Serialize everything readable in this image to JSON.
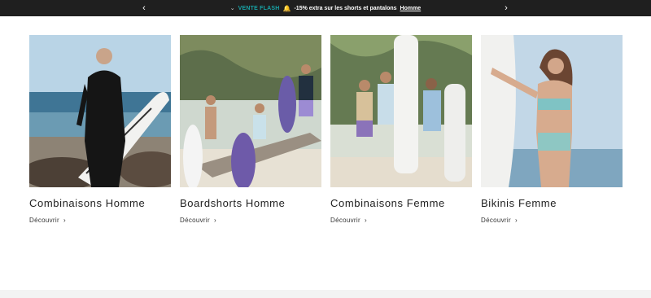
{
  "announcement": {
    "prev_icon": "chevron-left-icon",
    "next_icon": "chevron-right-icon",
    "chevron": "⌄",
    "flash_label": "VENTE FLASH",
    "bell_icon": "🔔",
    "message": "-15% extra sur les shorts et pantalons",
    "link_label": "Homme",
    "colors": {
      "bar": "#1f1f1f",
      "flash": "#18a3a6",
      "bell": "#e2b32a"
    }
  },
  "categories": [
    {
      "title": "Combinaisons Homme",
      "cta": "Découvrir",
      "image": "man-wetsuit-surfboard-beach"
    },
    {
      "title": "Boardshorts Homme",
      "cta": "Découvrir",
      "image": "men-boardshorts-surfboards-driftwood"
    },
    {
      "title": "Combinaisons Femme",
      "cta": "Découvrir",
      "image": "women-surf-suits-longboards-palms"
    },
    {
      "title": "Bikinis Femme",
      "cta": "Découvrir",
      "image": "woman-bikini-surfboard-ocean"
    }
  ]
}
